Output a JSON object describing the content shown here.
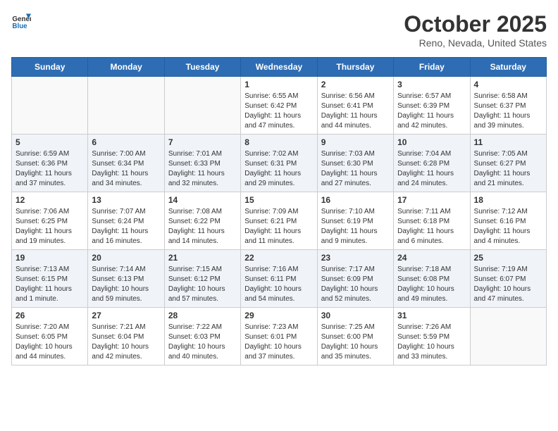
{
  "header": {
    "logo_general": "General",
    "logo_blue": "Blue",
    "title": "October 2025",
    "subtitle": "Reno, Nevada, United States"
  },
  "weekdays": [
    "Sunday",
    "Monday",
    "Tuesday",
    "Wednesday",
    "Thursday",
    "Friday",
    "Saturday"
  ],
  "weeks": [
    [
      {
        "day": "",
        "sunrise": "",
        "sunset": "",
        "daylight": ""
      },
      {
        "day": "",
        "sunrise": "",
        "sunset": "",
        "daylight": ""
      },
      {
        "day": "",
        "sunrise": "",
        "sunset": "",
        "daylight": ""
      },
      {
        "day": "1",
        "sunrise": "Sunrise: 6:55 AM",
        "sunset": "Sunset: 6:42 PM",
        "daylight": "Daylight: 11 hours and 47 minutes."
      },
      {
        "day": "2",
        "sunrise": "Sunrise: 6:56 AM",
        "sunset": "Sunset: 6:41 PM",
        "daylight": "Daylight: 11 hours and 44 minutes."
      },
      {
        "day": "3",
        "sunrise": "Sunrise: 6:57 AM",
        "sunset": "Sunset: 6:39 PM",
        "daylight": "Daylight: 11 hours and 42 minutes."
      },
      {
        "day": "4",
        "sunrise": "Sunrise: 6:58 AM",
        "sunset": "Sunset: 6:37 PM",
        "daylight": "Daylight: 11 hours and 39 minutes."
      }
    ],
    [
      {
        "day": "5",
        "sunrise": "Sunrise: 6:59 AM",
        "sunset": "Sunset: 6:36 PM",
        "daylight": "Daylight: 11 hours and 37 minutes."
      },
      {
        "day": "6",
        "sunrise": "Sunrise: 7:00 AM",
        "sunset": "Sunset: 6:34 PM",
        "daylight": "Daylight: 11 hours and 34 minutes."
      },
      {
        "day": "7",
        "sunrise": "Sunrise: 7:01 AM",
        "sunset": "Sunset: 6:33 PM",
        "daylight": "Daylight: 11 hours and 32 minutes."
      },
      {
        "day": "8",
        "sunrise": "Sunrise: 7:02 AM",
        "sunset": "Sunset: 6:31 PM",
        "daylight": "Daylight: 11 hours and 29 minutes."
      },
      {
        "day": "9",
        "sunrise": "Sunrise: 7:03 AM",
        "sunset": "Sunset: 6:30 PM",
        "daylight": "Daylight: 11 hours and 27 minutes."
      },
      {
        "day": "10",
        "sunrise": "Sunrise: 7:04 AM",
        "sunset": "Sunset: 6:28 PM",
        "daylight": "Daylight: 11 hours and 24 minutes."
      },
      {
        "day": "11",
        "sunrise": "Sunrise: 7:05 AM",
        "sunset": "Sunset: 6:27 PM",
        "daylight": "Daylight: 11 hours and 21 minutes."
      }
    ],
    [
      {
        "day": "12",
        "sunrise": "Sunrise: 7:06 AM",
        "sunset": "Sunset: 6:25 PM",
        "daylight": "Daylight: 11 hours and 19 minutes."
      },
      {
        "day": "13",
        "sunrise": "Sunrise: 7:07 AM",
        "sunset": "Sunset: 6:24 PM",
        "daylight": "Daylight: 11 hours and 16 minutes."
      },
      {
        "day": "14",
        "sunrise": "Sunrise: 7:08 AM",
        "sunset": "Sunset: 6:22 PM",
        "daylight": "Daylight: 11 hours and 14 minutes."
      },
      {
        "day": "15",
        "sunrise": "Sunrise: 7:09 AM",
        "sunset": "Sunset: 6:21 PM",
        "daylight": "Daylight: 11 hours and 11 minutes."
      },
      {
        "day": "16",
        "sunrise": "Sunrise: 7:10 AM",
        "sunset": "Sunset: 6:19 PM",
        "daylight": "Daylight: 11 hours and 9 minutes."
      },
      {
        "day": "17",
        "sunrise": "Sunrise: 7:11 AM",
        "sunset": "Sunset: 6:18 PM",
        "daylight": "Daylight: 11 hours and 6 minutes."
      },
      {
        "day": "18",
        "sunrise": "Sunrise: 7:12 AM",
        "sunset": "Sunset: 6:16 PM",
        "daylight": "Daylight: 11 hours and 4 minutes."
      }
    ],
    [
      {
        "day": "19",
        "sunrise": "Sunrise: 7:13 AM",
        "sunset": "Sunset: 6:15 PM",
        "daylight": "Daylight: 11 hours and 1 minute."
      },
      {
        "day": "20",
        "sunrise": "Sunrise: 7:14 AM",
        "sunset": "Sunset: 6:13 PM",
        "daylight": "Daylight: 10 hours and 59 minutes."
      },
      {
        "day": "21",
        "sunrise": "Sunrise: 7:15 AM",
        "sunset": "Sunset: 6:12 PM",
        "daylight": "Daylight: 10 hours and 57 minutes."
      },
      {
        "day": "22",
        "sunrise": "Sunrise: 7:16 AM",
        "sunset": "Sunset: 6:11 PM",
        "daylight": "Daylight: 10 hours and 54 minutes."
      },
      {
        "day": "23",
        "sunrise": "Sunrise: 7:17 AM",
        "sunset": "Sunset: 6:09 PM",
        "daylight": "Daylight: 10 hours and 52 minutes."
      },
      {
        "day": "24",
        "sunrise": "Sunrise: 7:18 AM",
        "sunset": "Sunset: 6:08 PM",
        "daylight": "Daylight: 10 hours and 49 minutes."
      },
      {
        "day": "25",
        "sunrise": "Sunrise: 7:19 AM",
        "sunset": "Sunset: 6:07 PM",
        "daylight": "Daylight: 10 hours and 47 minutes."
      }
    ],
    [
      {
        "day": "26",
        "sunrise": "Sunrise: 7:20 AM",
        "sunset": "Sunset: 6:05 PM",
        "daylight": "Daylight: 10 hours and 44 minutes."
      },
      {
        "day": "27",
        "sunrise": "Sunrise: 7:21 AM",
        "sunset": "Sunset: 6:04 PM",
        "daylight": "Daylight: 10 hours and 42 minutes."
      },
      {
        "day": "28",
        "sunrise": "Sunrise: 7:22 AM",
        "sunset": "Sunset: 6:03 PM",
        "daylight": "Daylight: 10 hours and 40 minutes."
      },
      {
        "day": "29",
        "sunrise": "Sunrise: 7:23 AM",
        "sunset": "Sunset: 6:01 PM",
        "daylight": "Daylight: 10 hours and 37 minutes."
      },
      {
        "day": "30",
        "sunrise": "Sunrise: 7:25 AM",
        "sunset": "Sunset: 6:00 PM",
        "daylight": "Daylight: 10 hours and 35 minutes."
      },
      {
        "day": "31",
        "sunrise": "Sunrise: 7:26 AM",
        "sunset": "Sunset: 5:59 PM",
        "daylight": "Daylight: 10 hours and 33 minutes."
      },
      {
        "day": "",
        "sunrise": "",
        "sunset": "",
        "daylight": ""
      }
    ]
  ]
}
